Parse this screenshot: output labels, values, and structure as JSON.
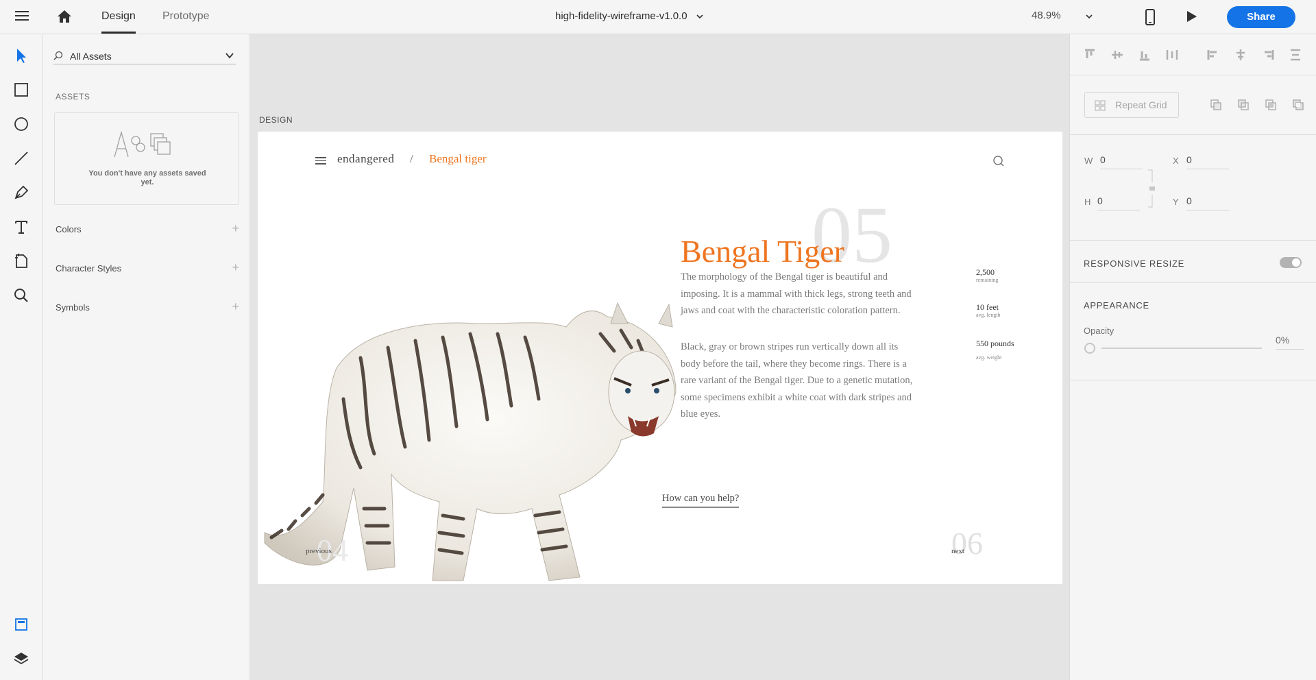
{
  "topbar": {
    "tabs": [
      "Design",
      "Prototype"
    ],
    "doc_title": "high-fidelity-wireframe-v1.0.0",
    "zoom": "48.9%",
    "share_label": "Share"
  },
  "left_panel": {
    "search_value": "All Assets",
    "assets_heading": "ASSETS",
    "empty_message": "You don't have any assets saved yet.",
    "sections": [
      "Colors",
      "Character Styles",
      "Symbols"
    ]
  },
  "canvas": {
    "artboard_label": "DESIGN"
  },
  "artboard": {
    "breadcrumb_root": "endangered",
    "breadcrumb_sep": "/",
    "breadcrumb_current": "Bengal tiger",
    "page_number": "05",
    "title": "Bengal Tiger",
    "paragraph1": "The morphology of the Bengal tiger is beautiful and imposing. It is a mammal with thick legs, strong teeth and jaws and coat with the characteristic coloration pattern.",
    "paragraph2": "Black, gray or brown stripes run vertically down all its body before the tail, where they become rings. There is a rare variant of the Bengal tiger. Due to a genetic mutation, some specimens exhibit a white coat with dark stripes and blue eyes.",
    "stats": [
      {
        "value": "2,500",
        "label": "remaining"
      },
      {
        "value": "10 feet",
        "label": "avg. length"
      },
      {
        "value": "550 pounds",
        "label": "avg. weight"
      }
    ],
    "cta": "How can you help?",
    "prev_number": "04",
    "prev_label": "previous",
    "next_number": "06",
    "next_label": "next",
    "accent_color": "#ee7520"
  },
  "right_panel": {
    "repeat_grid_label": "Repeat Grid",
    "w_label": "W",
    "w_value": "0",
    "h_label": "H",
    "h_value": "0",
    "x_label": "X",
    "x_value": "0",
    "y_label": "Y",
    "y_value": "0",
    "responsive_resize": "RESPONSIVE RESIZE",
    "appearance": "APPEARANCE",
    "opacity_label": "Opacity",
    "opacity_value": "0%"
  },
  "colors": {
    "share_button": "#1473e6",
    "select_tool_active": "#1473e6"
  }
}
